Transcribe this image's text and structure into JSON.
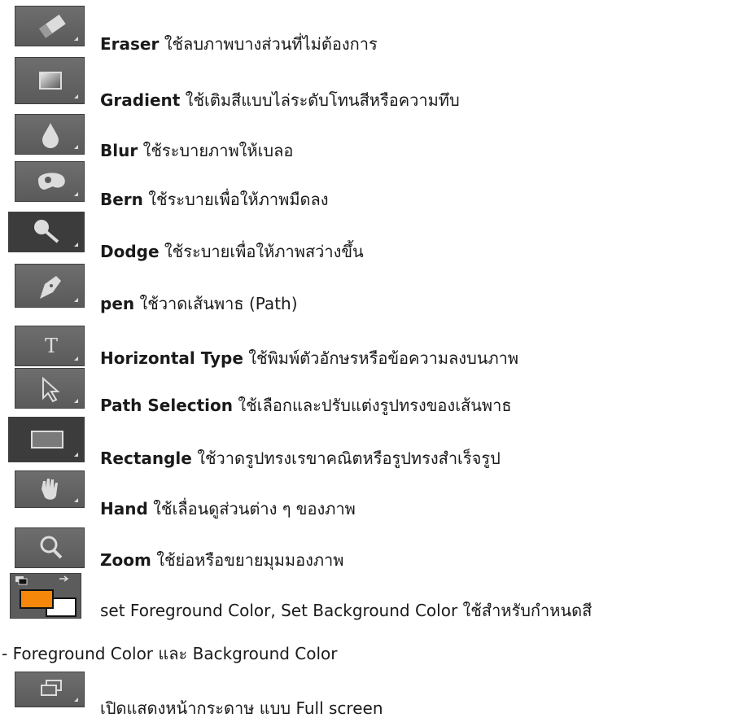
{
  "tools": [
    {
      "icon": "eraser-icon",
      "name": "Eraser",
      "description": "ใช้ลบภาพบางส่วนที่ไม่ต้องการ"
    },
    {
      "icon": "gradient-icon",
      "name": "Gradient",
      "description": "ใช้เติมสีแบบไล่ระดับโทนสีหรือความทึบ"
    },
    {
      "icon": "blur-icon",
      "name": "Blur",
      "description": "ใช้ระบายภาพให้เบลอ"
    },
    {
      "icon": "burn-icon",
      "name": "Bern",
      "description": "ใช้ระบายเพื่อให้ภาพมืดลง"
    },
    {
      "icon": "dodge-icon",
      "name": "Dodge",
      "description": "ใช้ระบายเพื่อให้ภาพสว่างขึ้น"
    },
    {
      "icon": "pen-icon",
      "name": "pen",
      "description": "ใช้วาดเส้นพาธ (Path)"
    },
    {
      "icon": "horizontal-type-icon",
      "name": "Horizontal Type",
      "description": "ใช้พิมพ์ตัวอักษรหรือข้อความลงบนภาพ"
    },
    {
      "icon": "path-selection-icon",
      "name": "Path Selection",
      "description": " ใช้เลือกและปรับแต่งรูปทรงของเส้นพาธ"
    },
    {
      "icon": "rectangle-icon",
      "name": "Rectangle",
      "description": " ใช้วาดรูปทรงเรขาคณิตหรือรูปทรงสำเร็จรูป"
    },
    {
      "icon": "hand-icon",
      "name": "Hand",
      "description": " ใช้เลื่อนดูส่วนต่าง ๆ ของภาพ"
    },
    {
      "icon": "zoom-icon",
      "name": "Zoom",
      "description": " ใช้ย่อหรือขยายมุมมองภาพ"
    }
  ],
  "color_tool": {
    "icon": "foreground-background-color-icon",
    "text": "set Foreground Color, Set Background Color ใช้สำหรับกำหนดสี",
    "continuation": "- Foreground Color และ  Background Color",
    "foreground_color": "#f5870a",
    "background_color": "#ffffff"
  },
  "screen_mode": {
    "icon": "screen-mode-icon",
    "text": "เปิดแสดงหน้ากระดาษ แบบ Full screen"
  },
  "colors": {
    "icon_bg": "#646464",
    "icon_glyph": "#dcdcdc",
    "text": "#1a1a1a"
  }
}
